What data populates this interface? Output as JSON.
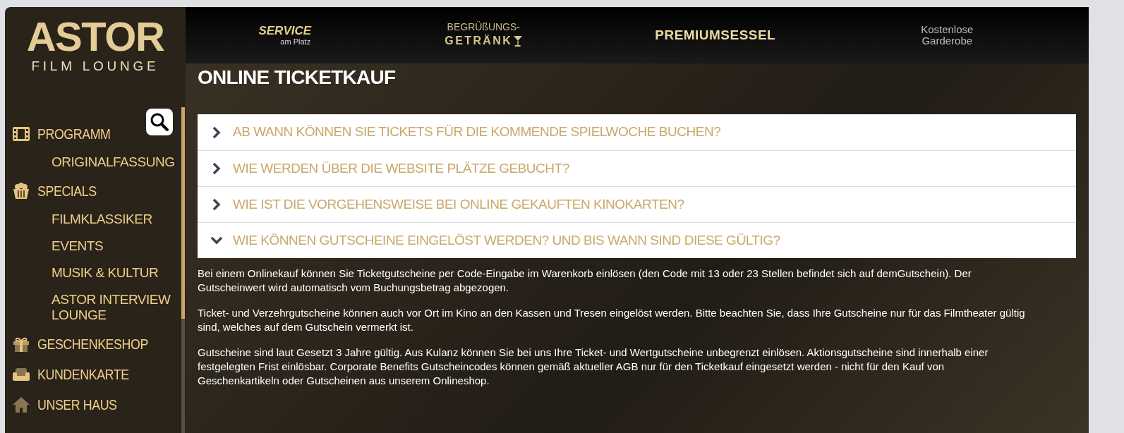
{
  "logo": {
    "title": "ASTOR",
    "subtitle": "FILM LOUNGE"
  },
  "banner": [
    {
      "kind": "service",
      "line1": "SERVICE",
      "line2": "am Platz"
    },
    {
      "kind": "drink",
      "line1": "BEGRÜßUNGS-",
      "line2": "GETRÄNK"
    },
    {
      "kind": "seat",
      "line1": "PREMIUMSESSEL"
    },
    {
      "kind": "wardrobe",
      "line1": "Kostenlose",
      "line2": "Garderobe"
    }
  ],
  "nav": [
    {
      "label": "PROGRAMM",
      "kind": "film",
      "children": [
        {
          "label": "ORIGINALFASSUNG"
        }
      ]
    },
    {
      "label": "SPECIALS",
      "kind": "popcorn",
      "children": [
        {
          "label": "FILMKLASSIKER"
        },
        {
          "label": "EVENTS"
        },
        {
          "label": "MUSIK & KULTUR"
        },
        {
          "label": "ASTOR INTERVIEW LOUNGE"
        }
      ]
    },
    {
      "label": "GESCHENKESHOP",
      "kind": "gift"
    },
    {
      "label": "KUNDENKARTE",
      "kind": "sofa"
    },
    {
      "label": "UNSER HAUS",
      "kind": "house"
    }
  ],
  "page_title": "ONLINE TICKETKAUF",
  "faq": [
    {
      "question": "AB WANN KÖNNEN SIE TICKETS FÜR DIE KOMMENDE SPIELWOCHE BUCHEN?",
      "expanded": false
    },
    {
      "question": "WIE WERDEN ÜBER DIE WEBSITE PLÄTZE GEBUCHT?",
      "expanded": false
    },
    {
      "question": "WIE IST DIE VORGEHENSWEISE BEI ONLINE GEKAUFTEN KINOKARTEN?",
      "expanded": false
    },
    {
      "question": "WIE KÖNNEN GUTSCHEINE EINGELÖST WERDEN? UND BIS WANN SIND DIESE GÜLTIG?",
      "expanded": true,
      "answer": [
        "Bei einem Onlinekauf können Sie Ticketgutscheine per Code-Eingabe im Warenkorb einlösen (den Code mit 13 oder 23 Stellen befindet sich auf demGutschein). Der Gutscheinwert wird automatisch vom Buchungsbetrag abgezogen.",
        "Ticket- und Verzehrgutscheine können auch vor Ort im Kino an den Kassen und Tresen eingelöst werden. Bitte beachten Sie, dass Ihre Gutscheine nur für das Filmtheater gültig sind, welches auf dem Gutschein vermerkt ist.",
        "Gutscheine sind laut Gesetzt 3 Jahre gültig. Aus Kulanz können Sie bei uns Ihre Ticket- und Wertgutscheine unbegrenzt einlösen. Aktionsgutscheine sind innerhalb einer festgelegten Frist einlösbar. Corporate Benefits Gutscheincodes können gemäß aktueller AGB nur für den Ticketkauf eingesetzt werden - nicht für den Kauf von Geschenkartikeln oder Gutscheinen aus unserem Onlineshop."
      ]
    }
  ]
}
